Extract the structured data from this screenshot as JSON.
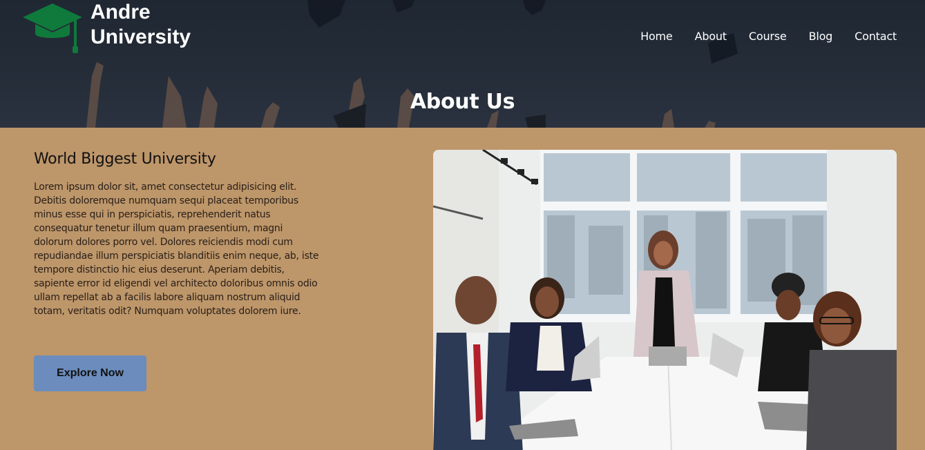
{
  "brand": {
    "line1": "Andre",
    "line2": "University"
  },
  "nav": {
    "items": [
      {
        "label": "Home"
      },
      {
        "label": "About"
      },
      {
        "label": "Course"
      },
      {
        "label": "Blog"
      },
      {
        "label": "Contact"
      }
    ]
  },
  "hero": {
    "title": "About Us"
  },
  "about": {
    "heading": "World Biggest University",
    "body": "Lorem ipsum dolor sit, amet consectetur adipisicing elit. Debitis doloremque numquam sequi placeat temporibus minus esse qui in perspiciatis, reprehenderit natus consequatur tenetur illum quam praesentium, magni dolorum dolores porro vel. Dolores reiciendis modi cum repudiandae illum perspiciatis blanditiis enim neque, ab, iste tempore distinctio hic eius deserunt. Aperiam debitis, sapiente error id eligendi vel architecto doloribus omnis odio ullam repellat ab a facilis labore aliquam nostrum aliquid totam, veritatis odit? Numquam voluptates dolorem iure.",
    "button_label": "Explore Now"
  },
  "colors": {
    "content_bg": "#bd966a",
    "hero_bg": "#252d39",
    "logo_green": "#0f7a3c",
    "button_bg": "#6b8cbd"
  },
  "icons": {
    "logo": "graduation-cap-icon"
  }
}
